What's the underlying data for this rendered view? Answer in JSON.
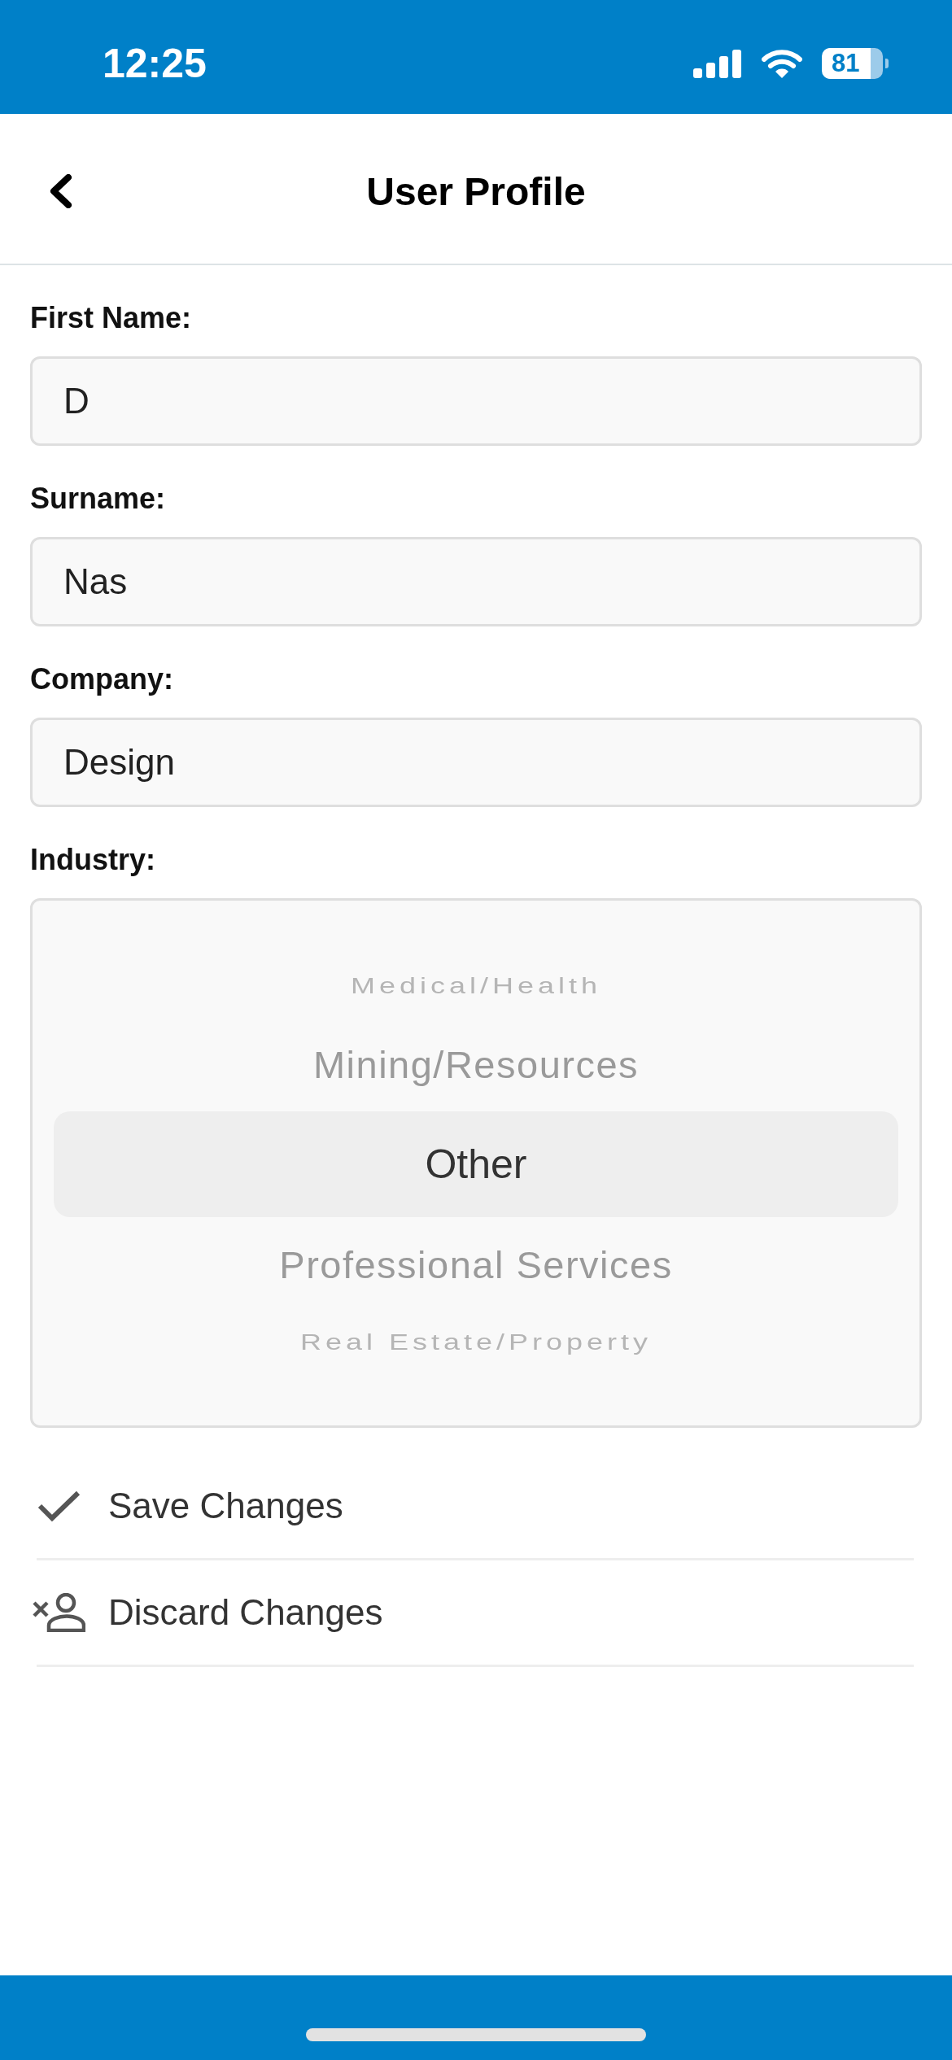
{
  "status_bar": {
    "time": "12:25",
    "battery": "81"
  },
  "header": {
    "title": "User Profile"
  },
  "fields": [
    {
      "label": "First Name:",
      "value": "D"
    },
    {
      "label": "Surname:",
      "value": "Nas"
    },
    {
      "label": "Company:",
      "value": "Design"
    }
  ],
  "industry": {
    "label": "Industry:",
    "options": [
      {
        "label": "Medical/Health",
        "selected": false
      },
      {
        "label": "Mining/Resources",
        "selected": false
      },
      {
        "label": "Other",
        "selected": true
      },
      {
        "label": "Professional Services",
        "selected": false
      },
      {
        "label": "Real Estate/Property",
        "selected": false
      }
    ]
  },
  "actions": [
    {
      "kind": "save",
      "label": "Save Changes"
    },
    {
      "kind": "discard",
      "label": "Discard Changes"
    }
  ]
}
